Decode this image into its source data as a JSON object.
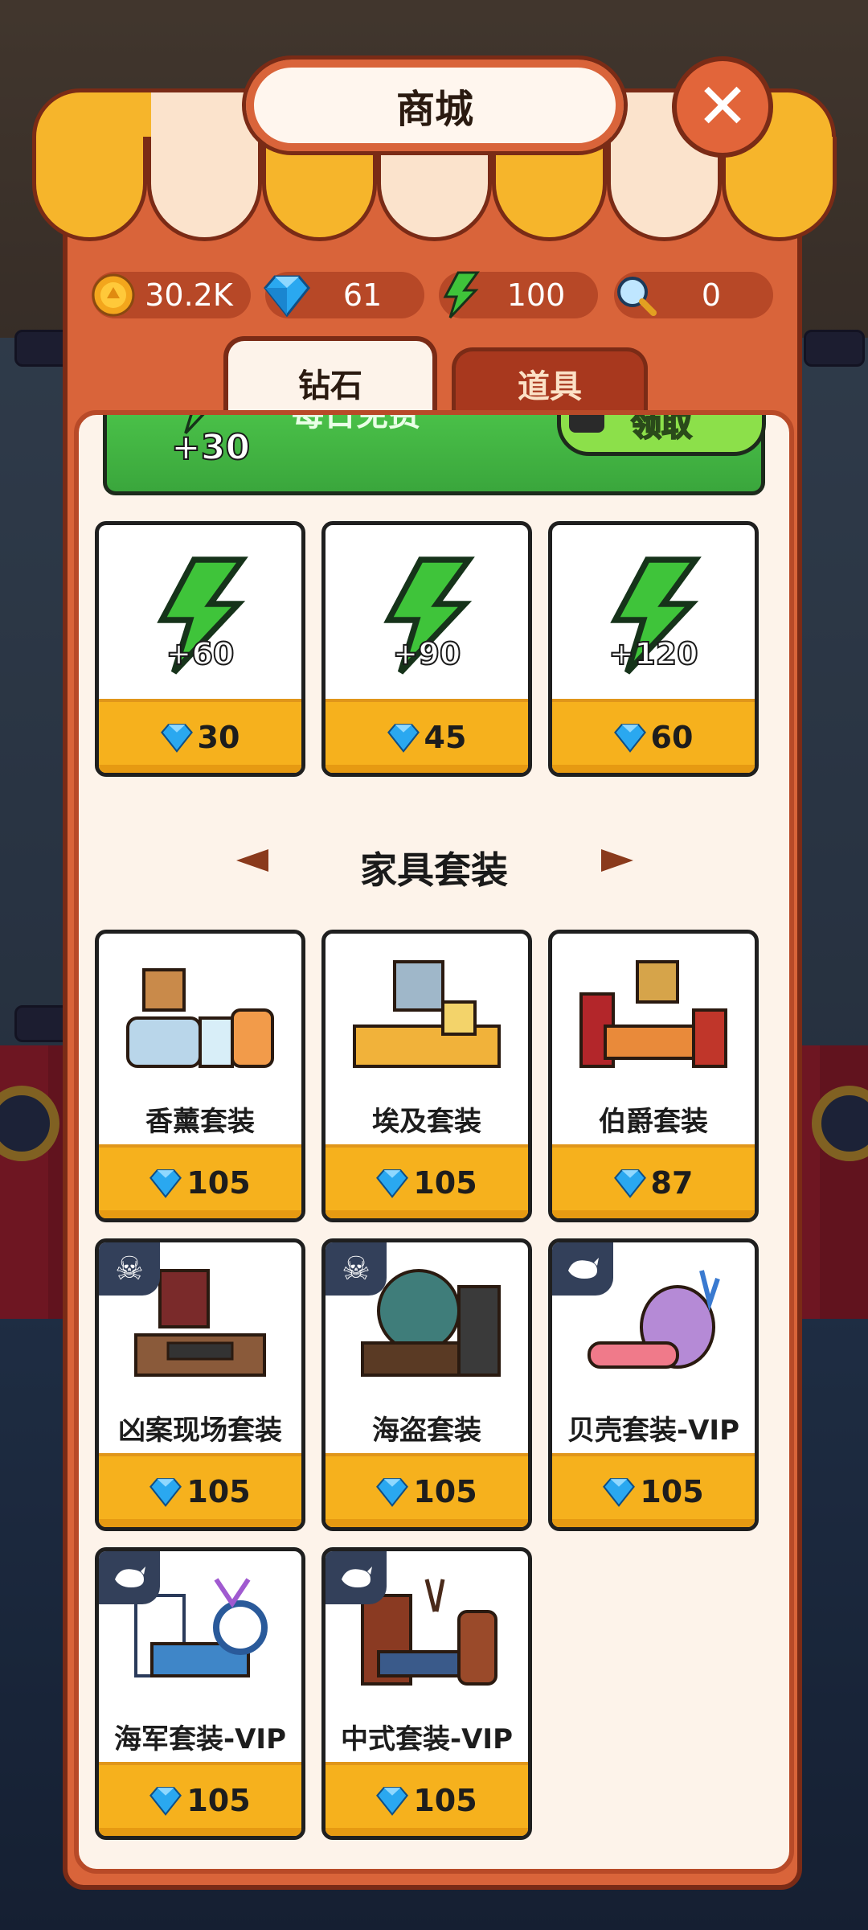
{
  "shop": {
    "title": "商城",
    "close_icon": "close-icon"
  },
  "resources": [
    {
      "icon": "coin-icon",
      "value": "30.2K"
    },
    {
      "icon": "diamond-icon",
      "value": "61"
    },
    {
      "icon": "energy-icon",
      "value": "100"
    },
    {
      "icon": "magnifier-icon",
      "value": "0"
    }
  ],
  "tabs": [
    {
      "label": "钻石",
      "active": true
    },
    {
      "label": "道具",
      "active": false
    }
  ],
  "daily_free": {
    "title": "每日免费",
    "amount": "+30",
    "button_label": "领取"
  },
  "energy_packs": [
    {
      "amount": "+60",
      "price": "30"
    },
    {
      "amount": "+90",
      "price": "45"
    },
    {
      "amount": "+120",
      "price": "60"
    }
  ],
  "furniture_section": {
    "title": "家具套装"
  },
  "furniture_sets": [
    {
      "name": "香薰套装",
      "price": "105",
      "badge": ""
    },
    {
      "name": "埃及套装",
      "price": "105",
      "badge": ""
    },
    {
      "name": "伯爵套装",
      "price": "87",
      "badge": ""
    },
    {
      "name": "凶案现场套装",
      "price": "105",
      "badge": "skull-icon"
    },
    {
      "name": "海盗套装",
      "price": "105",
      "badge": "skull-icon"
    },
    {
      "name": "贝壳套装-VIP",
      "price": "105",
      "badge": "whale-icon"
    },
    {
      "name": "海军套装-VIP",
      "price": "105",
      "badge": "whale-icon"
    },
    {
      "name": "中式套装-VIP",
      "price": "105",
      "badge": "whale-icon"
    }
  ],
  "colors": {
    "panel": "#d9643a",
    "price_bar": "#f6b11d",
    "energy_green": "#3fc43a",
    "diamond_blue": "#2aa8f0"
  }
}
